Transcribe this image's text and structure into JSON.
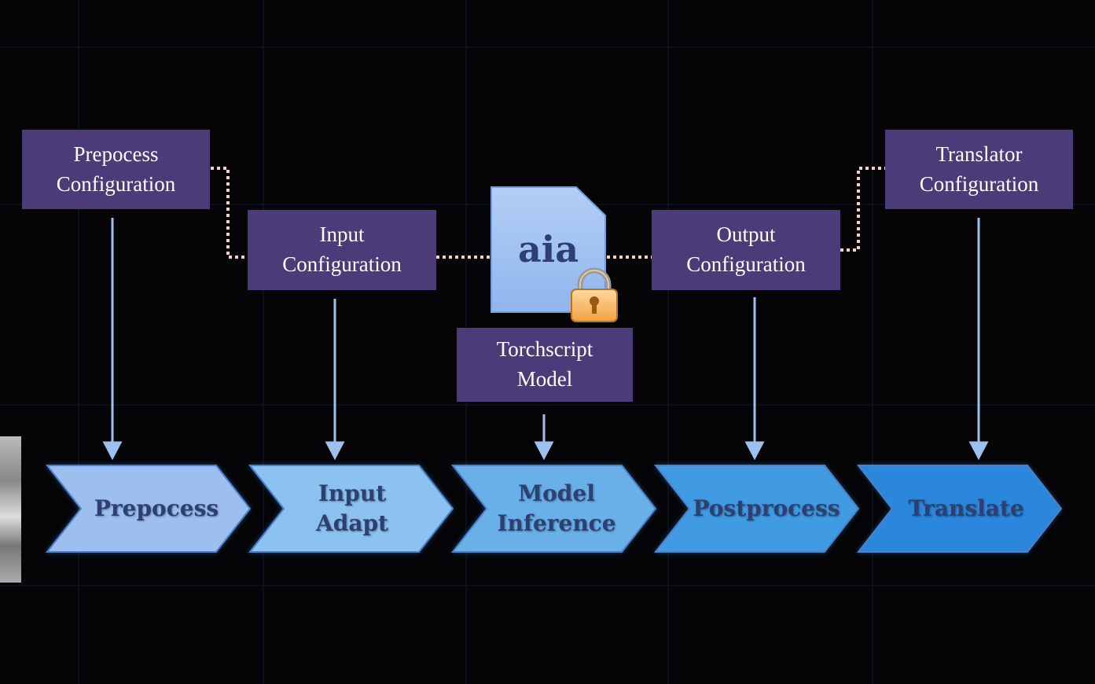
{
  "config_boxes": {
    "prepocess": {
      "line1": "Prepocess",
      "line2": "Configuration"
    },
    "input": {
      "line1": "Input",
      "line2": "Configuration"
    },
    "output": {
      "line1": "Output",
      "line2": "Configuration"
    },
    "translator": {
      "line1": "Translator",
      "line2": "Configuration"
    },
    "model": {
      "line1": "Torchscript",
      "line2": "Model"
    }
  },
  "file_icon": {
    "label": "aia",
    "icon": "locked-file-icon"
  },
  "pipeline": [
    {
      "line1": "Prepocess",
      "line2": "",
      "color": "#9dbff0"
    },
    {
      "line1": "Input",
      "line2": "Adapt",
      "color": "#8cc2ef"
    },
    {
      "line1": "Model",
      "line2": "Inference",
      "color": "#69b0e8"
    },
    {
      "line1": "Postprocess",
      "line2": "",
      "color": "#3f9be3"
    },
    {
      "line1": "Translate",
      "line2": "",
      "color": "#2c87dc"
    }
  ],
  "colors": {
    "config_box": "#4b3b78",
    "arrow": "#9ec0ee",
    "dotted_link": "#f3cfc6",
    "background": "#050507"
  }
}
